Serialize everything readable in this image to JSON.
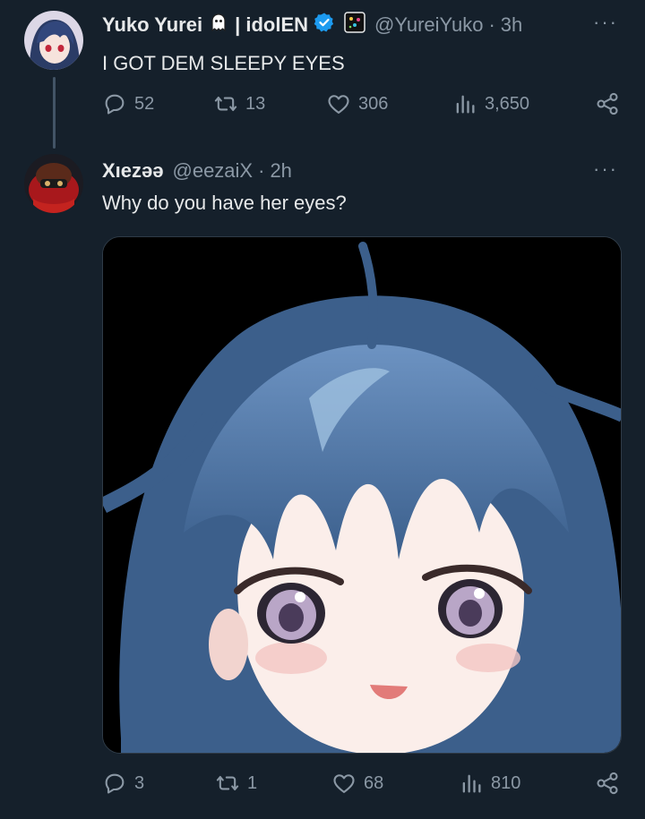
{
  "tweet1": {
    "name": "Yuko Yurei",
    "name_suffix": "| idolEN",
    "handle": "@YureiYuko",
    "time": "3h",
    "text": "I GOT DEM SLEEPY EYES",
    "replies": "52",
    "retweets": "13",
    "likes": "306",
    "views": "3,650"
  },
  "tweet2": {
    "name": "Xıezəə",
    "handle": "@eezaiX",
    "time": "2h",
    "text": "Why do you have her eyes?",
    "replies": "3",
    "retweets": "1",
    "likes": "68",
    "views": "810"
  },
  "more_label": "···",
  "separator": "·",
  "colors": {
    "background": "#15202b",
    "text": "#e7e9ea",
    "muted": "#8b98a5",
    "verified": "#1d9bf0"
  }
}
